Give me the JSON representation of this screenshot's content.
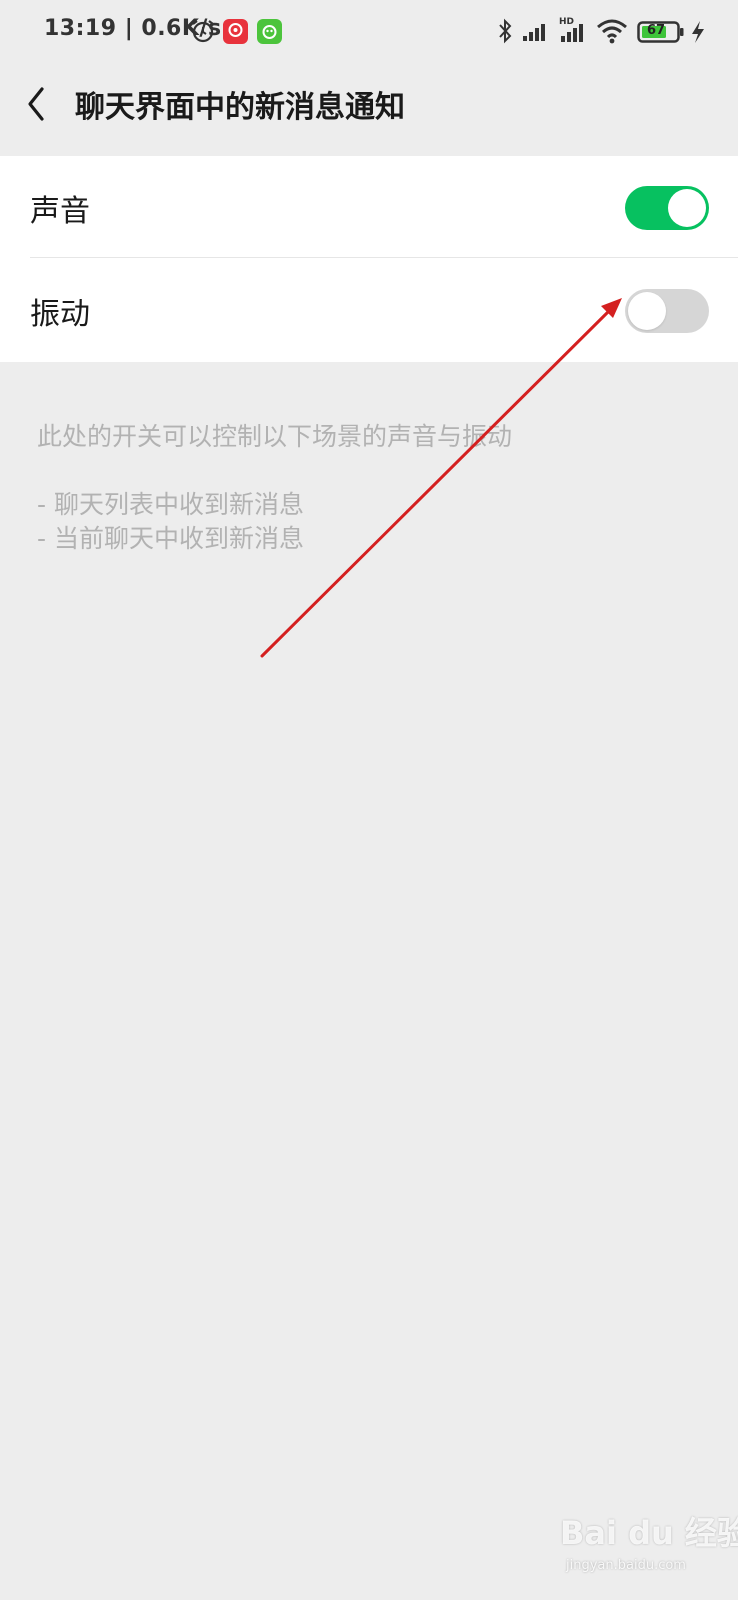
{
  "status_bar": {
    "time": "13:19 | 0.6K/s",
    "battery_level": "67",
    "icons": [
      "alarm-icon",
      "netease-music-app-icon",
      "green-app-icon",
      "bluetooth-icon",
      "signal-icon",
      "hd-signal-icon",
      "wifi-icon",
      "battery-icon",
      "charging-icon"
    ]
  },
  "header": {
    "back_icon": "chevron-left-icon",
    "title": "聊天界面中的新消息通知"
  },
  "settings": [
    {
      "label": "声音",
      "enabled": true
    },
    {
      "label": "振动",
      "enabled": false
    }
  ],
  "description": {
    "intro": "此处的开关可以控制以下场景的声音与振动",
    "items": [
      "- 聊天列表中收到新消息",
      "- 当前聊天中收到新消息"
    ]
  },
  "watermark": {
    "main": "Bai du 经验",
    "sub": "jingyan.baidu.com"
  },
  "colors": {
    "accent_green": "#07c160",
    "toggle_off": "#d6d6d6",
    "background": "#ededed",
    "annotation_red": "#d42020"
  }
}
